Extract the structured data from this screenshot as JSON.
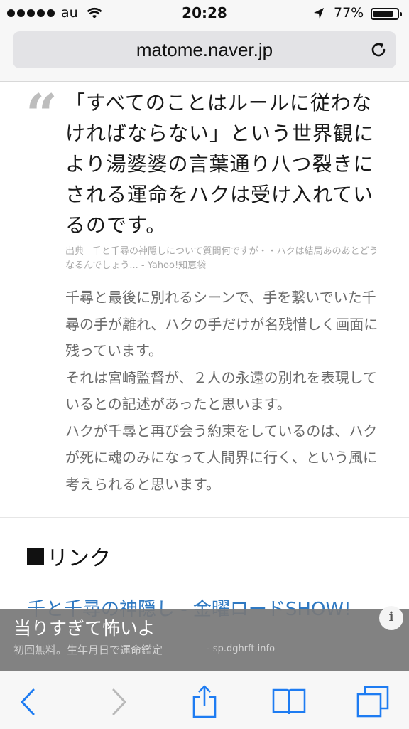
{
  "status_bar": {
    "carrier": "au",
    "time": "20:28",
    "battery_percent": "77%",
    "battery_level": 0.77,
    "signal_icon": "signal-dots-icon",
    "wifi_icon": "wifi-icon",
    "location_icon": "location-arrow-icon",
    "battery_icon": "battery-icon"
  },
  "url_bar": {
    "domain": "matome.naver.jp",
    "reload_icon": "reload-icon"
  },
  "article": {
    "quote_mark": "“",
    "quote": "「すべてのことはルールに従わなければならない」という世界観により湯婆婆の言葉通り八つ裂きにされる運命をハクは受け入れているのです。",
    "source_label": "出典",
    "source_text": "千と千尋の神隠しについて質問何ですが・・ハクは結局あのあとどうなるんでしょう... - Yahoo!知恵袋",
    "body_lines": [
      "千尋と最後に別れるシーンで、手を繋いでいた千尋の手が離れ、ハクの手だけが名残惜しく画面に残っています。",
      "それは宮崎監督が、２人の永遠の別れを表現しているとの記述があったと思います。",
      "ハクが千尋と再び会う約束をしているのは、ハクが死に魂のみになって人間界に行く、という風に考えられると思います。"
    ]
  },
  "links_section": {
    "heading": "リンク",
    "first_link": "千と千尋の神隠し - 金曜ロードSHOW!"
  },
  "ad": {
    "title": "当りすぎて怖いよ",
    "subtitle": "初回無料。生年月日で運命鑑定",
    "url": "- sp.dghrft.info",
    "info_label": "i"
  },
  "toolbar": {
    "icons": [
      "back-icon",
      "forward-icon",
      "share-icon",
      "bookmarks-icon",
      "tabs-icon"
    ]
  },
  "colors": {
    "link": "#2f79c2",
    "toolbar_icon": "#1e7cf2",
    "disabled_icon": "#b9b9b9",
    "ad_background": "#787878"
  }
}
